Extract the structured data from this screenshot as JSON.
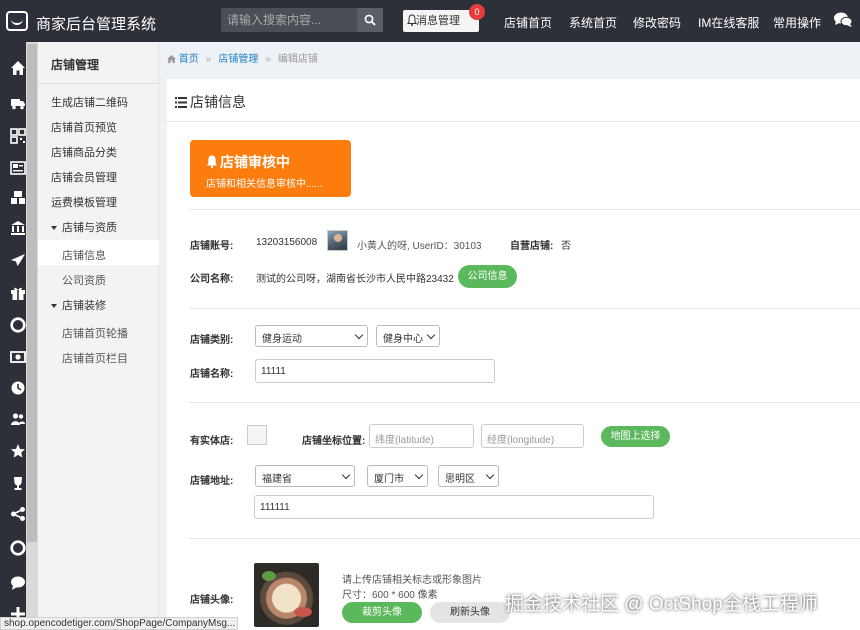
{
  "header": {
    "app_title": "商家后台管理系统",
    "search_placeholder": "请输入搜索内容...",
    "message_label": "消息管理",
    "message_count": "0",
    "nav": [
      "店铺首页",
      "系统首页",
      "修改密码",
      "IM在线客服",
      "常用操作"
    ]
  },
  "rail_icons": [
    "home-icon",
    "truck-icon",
    "qrcode-icon",
    "newspaper-icon",
    "cubes-icon",
    "bank-icon",
    "plane-icon",
    "gift-icon",
    "lifebuoy-icon",
    "money-icon",
    "clock-icon",
    "users-icon",
    "star-icon",
    "trophy-icon",
    "share-icon",
    "lifering-icon",
    "comment-icon",
    "plus-icon"
  ],
  "sidebar": {
    "title": "店铺管理",
    "items": [
      {
        "label": "生成店铺二维码"
      },
      {
        "label": "店铺首页预览"
      },
      {
        "label": "店铺商品分类"
      },
      {
        "label": "店铺会员管理"
      },
      {
        "label": "运费模板管理"
      }
    ],
    "group1": {
      "label": "店铺与资质",
      "children": [
        "店铺信息",
        "公司资质"
      ]
    },
    "group2": {
      "label": "店铺装修",
      "children": [
        "店铺首页轮播",
        "店铺首页栏目"
      ]
    }
  },
  "breadcrumb": {
    "home": "首页",
    "section": "店铺管理",
    "current": "编辑店铺"
  },
  "panel": {
    "title": "店铺信息",
    "notice": {
      "title": "店铺审核中",
      "text": "店铺和相关信息审核中......"
    },
    "account": {
      "label": "店铺账号:",
      "value": "13203156008",
      "user_text": "小黄人的呀, UserID：30103",
      "self_label": "自营店铺:",
      "self_value": "否"
    },
    "company": {
      "label": "公司名称:",
      "value": "测试的公司呀，湖南省长沙市人民中路23432",
      "button": "公司信息"
    },
    "category": {
      "label": "店铺类别:",
      "primary": "健身运动",
      "secondary": "健身中心"
    },
    "name": {
      "label": "店铺名称:",
      "value": "11111"
    },
    "physical": {
      "label": "有实体店:"
    },
    "coords": {
      "label": "店铺坐标位置:",
      "lat_placeholder": "纬度(latitude)",
      "lng_placeholder": "经度(longitude)",
      "map_button": "地图上选择"
    },
    "address": {
      "label": "店铺地址:",
      "province": "福建省",
      "city": "厦门市",
      "district": "思明区",
      "detail": "111111"
    },
    "avatar": {
      "label": "店铺头像:",
      "hint": "请上传店铺相关标志或形象图片",
      "size": "尺寸：600 * 600 像素",
      "crop_button": "裁剪头像",
      "refresh_button": "刷新头像"
    }
  },
  "status_url": "shop.opencodetiger.com/ShopPage/CompanyMsg...",
  "watermark": "掘金技术社区 @ OctShop全栈工程师",
  "colors": {
    "topbar": "#2d3038",
    "notice": "#fd7c0e",
    "green_button": "#5cb85c",
    "badge": "#e73c3c",
    "link": "#1e7fc5"
  }
}
